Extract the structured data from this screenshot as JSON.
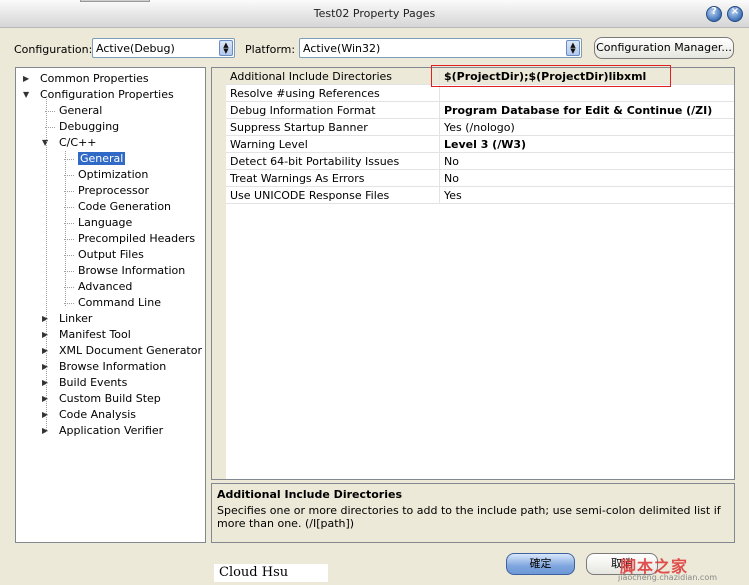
{
  "window": {
    "title": "Test02 Property Pages",
    "help_glyph": "?",
    "close_glyph": "×"
  },
  "toolbar": {
    "configuration_label": "Configuration:",
    "configuration_value": "Active(Debug)",
    "platform_label": "Platform:",
    "platform_value": "Active(Win32)",
    "config_manager_label": "Configuration Manager..."
  },
  "tree": [
    {
      "label": "Common Properties",
      "level": 0,
      "twist": "▶"
    },
    {
      "label": "Configuration Properties",
      "level": 0,
      "twist": "▼"
    },
    {
      "label": "General",
      "level": 1
    },
    {
      "label": "Debugging",
      "level": 1
    },
    {
      "label": "C/C++",
      "level": 1,
      "twist": "▼"
    },
    {
      "label": "General",
      "level": 2,
      "selected": true
    },
    {
      "label": "Optimization",
      "level": 2
    },
    {
      "label": "Preprocessor",
      "level": 2
    },
    {
      "label": "Code Generation",
      "level": 2
    },
    {
      "label": "Language",
      "level": 2
    },
    {
      "label": "Precompiled Headers",
      "level": 2
    },
    {
      "label": "Output Files",
      "level": 2
    },
    {
      "label": "Browse Information",
      "level": 2
    },
    {
      "label": "Advanced",
      "level": 2
    },
    {
      "label": "Command Line",
      "level": 2
    },
    {
      "label": "Linker",
      "level": 1,
      "twist": "▶"
    },
    {
      "label": "Manifest Tool",
      "level": 1,
      "twist": "▶"
    },
    {
      "label": "XML Document Generator",
      "level": 1,
      "twist": "▶"
    },
    {
      "label": "Browse Information",
      "level": 1,
      "twist": "▶"
    },
    {
      "label": "Build Events",
      "level": 1,
      "twist": "▶"
    },
    {
      "label": "Custom Build Step",
      "level": 1,
      "twist": "▶"
    },
    {
      "label": "Code Analysis",
      "level": 1,
      "twist": "▶"
    },
    {
      "label": "Application Verifier",
      "level": 1,
      "twist": "▶"
    }
  ],
  "properties": [
    {
      "name": "Additional Include Directories",
      "value": "$(ProjectDir);$(ProjectDir)libxml",
      "bold": true
    },
    {
      "name": "Resolve #using References",
      "value": ""
    },
    {
      "name": "Debug Information Format",
      "value": "Program Database for Edit & Continue (/ZI)",
      "bold": true
    },
    {
      "name": "Suppress Startup Banner",
      "value": "Yes (/nologo)"
    },
    {
      "name": "Warning Level",
      "value": "Level 3 (/W3)",
      "bold": true
    },
    {
      "name": "Detect 64-bit Portability Issues",
      "value": "No"
    },
    {
      "name": "Treat Warnings As Errors",
      "value": "No"
    },
    {
      "name": "Use UNICODE Response Files",
      "value": "Yes"
    }
  ],
  "description": {
    "title": "Additional Include Directories",
    "text": "Specifies one or more directories to add to the include path; use semi-colon delimited list if more than one. (/I[path])"
  },
  "buttons": {
    "ok_label": "確定",
    "cancel_label": "取消"
  },
  "signature": "Cloud Hsu",
  "watermark": {
    "main": "脚本之家",
    "sub": "jiaocheng.chazidian.com"
  }
}
